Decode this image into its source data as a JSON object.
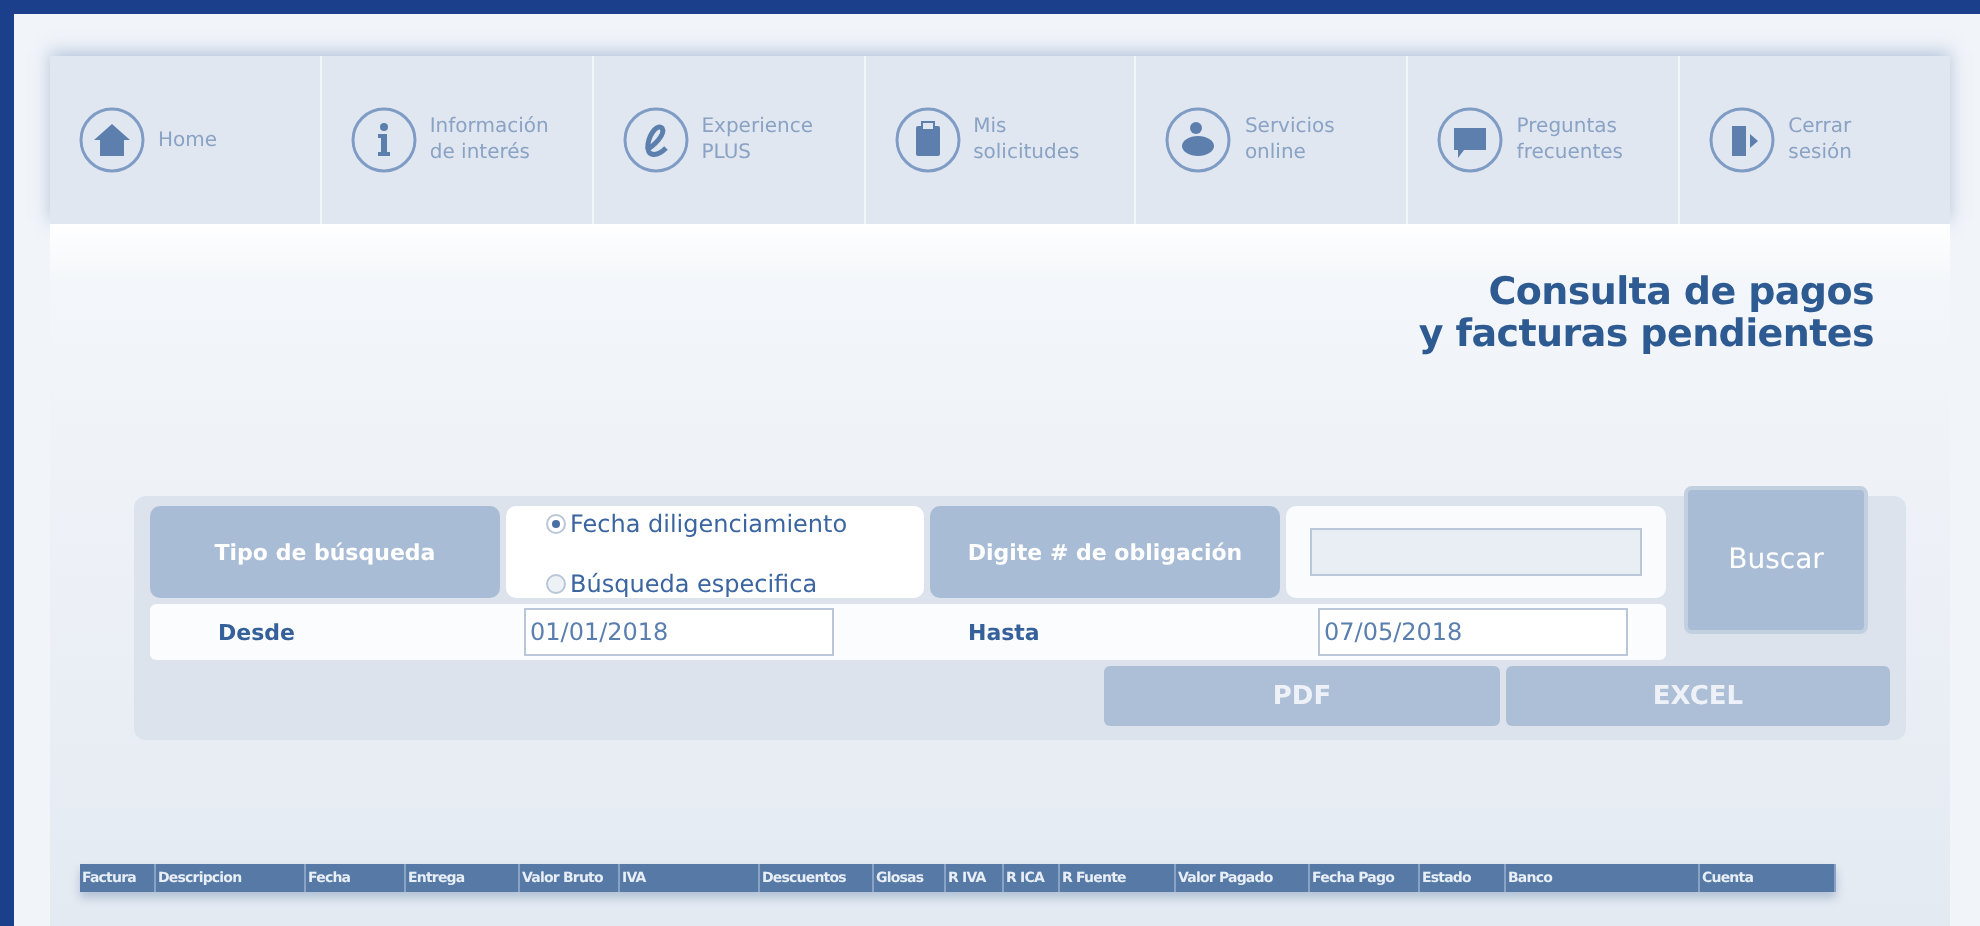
{
  "nav": [
    {
      "kind": "home",
      "lines": [
        "Home"
      ]
    },
    {
      "kind": "info",
      "lines": [
        "Información",
        "de interés"
      ]
    },
    {
      "kind": "experience",
      "lines": [
        "Experience",
        "PLUS"
      ]
    },
    {
      "kind": "requests",
      "lines": [
        "Mis",
        "solicitudes"
      ]
    },
    {
      "kind": "services",
      "lines": [
        "Servicios",
        "online"
      ]
    },
    {
      "kind": "faq",
      "lines": [
        "Preguntas",
        "frecuentes"
      ]
    },
    {
      "kind": "logout",
      "lines": [
        "Cerrar",
        "sesión"
      ]
    }
  ],
  "title": [
    "Consulta de pagos",
    "y facturas pendientes"
  ],
  "form": {
    "search_type_label": "Tipo de búsqueda",
    "options": [
      {
        "label": "Fecha diligenciamiento",
        "selected": true
      },
      {
        "label": "Búsqueda especifica",
        "selected": false
      }
    ],
    "obligation_label": "Digite # de obligación",
    "search_button": "Buscar",
    "from_label": "Desde",
    "from_value": "01/01/2018",
    "to_label": "Hasta",
    "to_value": "07/05/2018",
    "export_buttons": [
      "PDF",
      "EXCEL"
    ]
  },
  "table": {
    "columns": [
      "Factura",
      "Descripcion",
      "Fecha",
      "Entrega",
      "Valor Bruto",
      "IVA",
      "Descuentos",
      "Glosas",
      "R IVA",
      "R ICA",
      "R Fuente",
      "Valor Pagado",
      "Fecha Pago",
      "Estado",
      "Banco",
      "Cuenta"
    ]
  }
}
